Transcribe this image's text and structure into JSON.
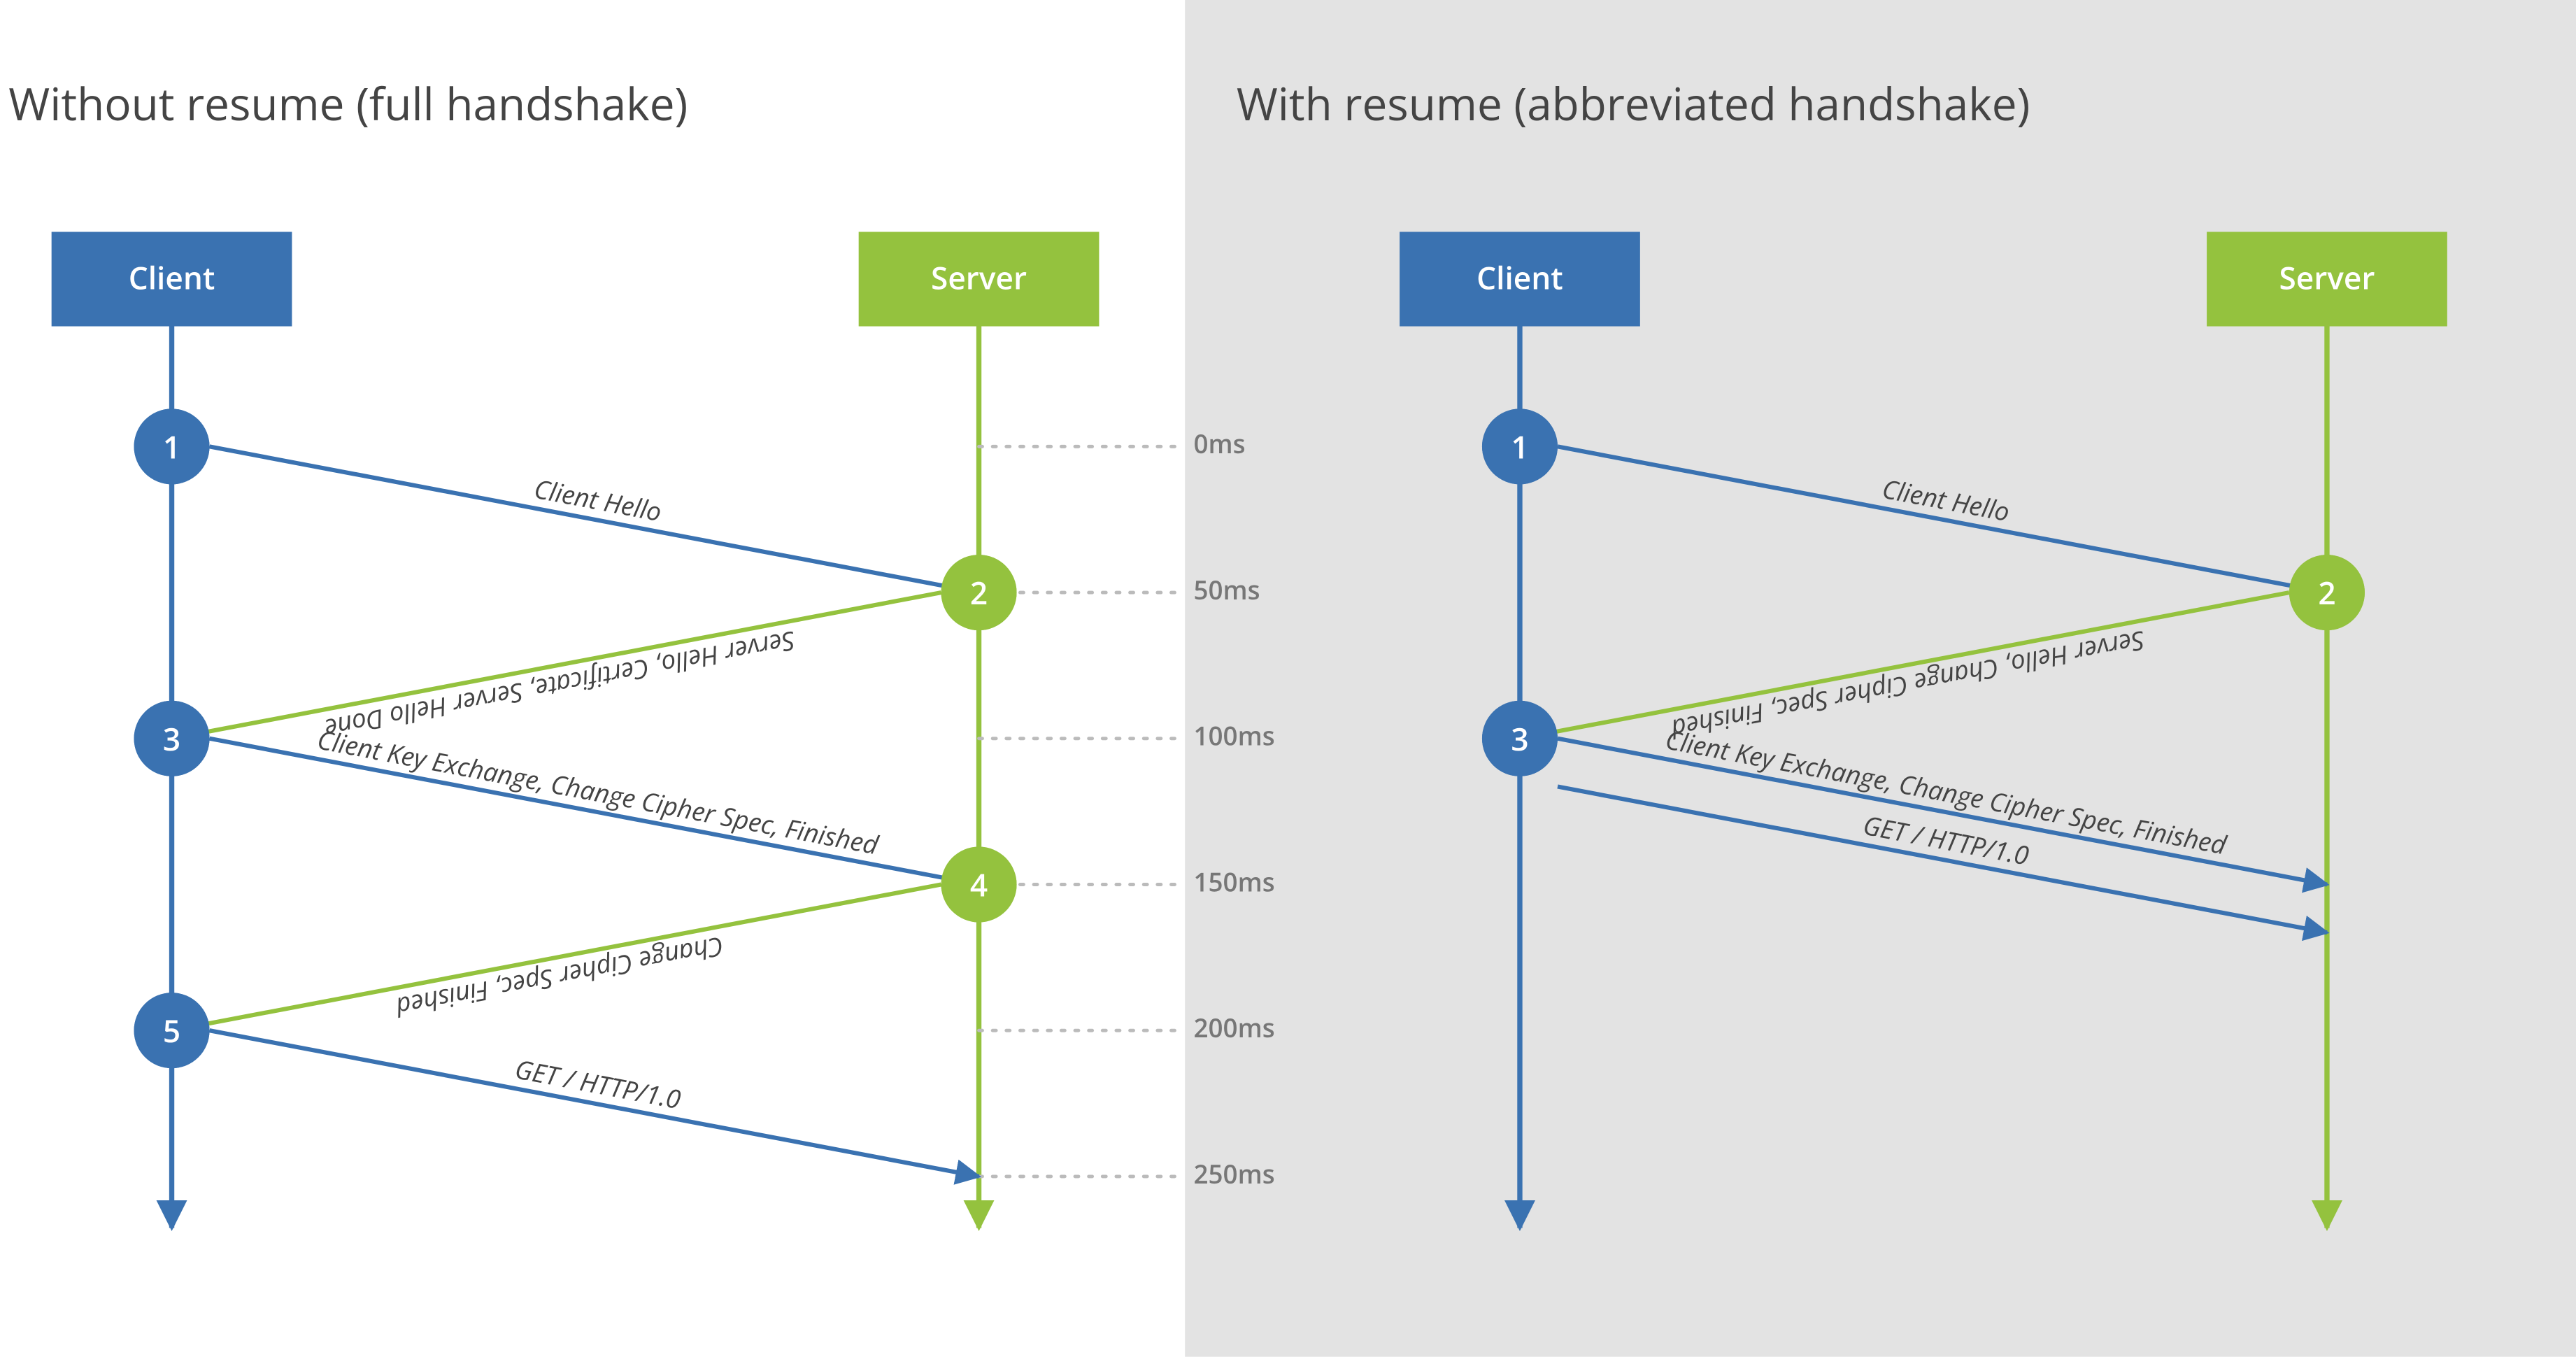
{
  "colors": {
    "blue": "#3a72b1",
    "green": "#94c23e",
    "grayBg": "#e3e3e3"
  },
  "titles": {
    "left": "Without resume (full handshake)",
    "right": "With resume (abbreviated handshake)"
  },
  "labels": {
    "client": "Client",
    "server": "Server"
  },
  "timeLabels": [
    "0ms",
    "50ms",
    "100ms",
    "150ms",
    "200ms",
    "250ms"
  ],
  "left": {
    "steps": [
      {
        "n": "1",
        "side": "client",
        "label": "Client Hello"
      },
      {
        "n": "2",
        "side": "server",
        "label": "Server Hello, Certificate, Server Hello Done"
      },
      {
        "n": "3",
        "side": "client",
        "label": "Client Key Exchange, Change Cipher Spec, Finished"
      },
      {
        "n": "4",
        "side": "server",
        "label": "Change Cipher Spec, Finished"
      },
      {
        "n": "5",
        "side": "client",
        "label": "GET / HTTP/1.0"
      }
    ]
  },
  "right": {
    "steps": [
      {
        "n": "1",
        "side": "client",
        "label": "Client Hello"
      },
      {
        "n": "2",
        "side": "server",
        "label": "Server Hello, Change Cipher Spec, Finished"
      },
      {
        "n": "3",
        "side": "client",
        "label": "Client Key Exchange, Change Cipher Spec, Finished"
      }
    ],
    "extraArrowLabel": "GET / HTTP/1.0"
  }
}
